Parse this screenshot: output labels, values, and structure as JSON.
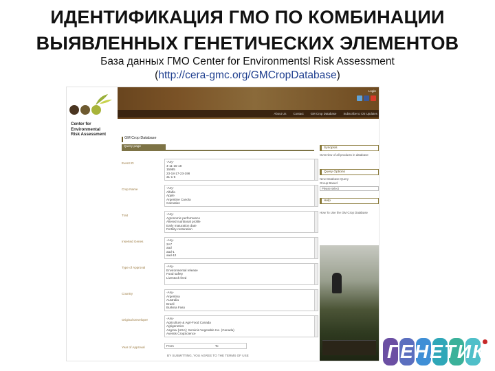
{
  "slide": {
    "title_line1": "ИДЕНТИФИКАЦИЯ ГМО ПО КОМБИНАЦИИ",
    "title_line2": "ВЫЯВЛЕННЫХ ГЕНЕТИЧЕСКИХ ЭЛЕМЕНТОВ",
    "subtitle_line1": "База данных ГМО Center for Environmentsl Risk Assessment",
    "subtitle_open": "(",
    "subtitle_url": "http://cera-gmc.org/GMCropDatabase",
    "subtitle_close": ")"
  },
  "screenshot": {
    "login": "Login",
    "nav": [
      "About Us",
      "Contact",
      "GM Crop Database",
      "Subscribe to CN Updates"
    ],
    "org_name": [
      "Center for",
      "Environmental",
      "Risk Assessment"
    ],
    "db_title": "GM Crop Database",
    "query_tab": "Query page",
    "rows": [
      {
        "label": "Event ID",
        "items": [
          "-Any-",
          "4-11-15-18",
          "15985",
          "23-18-17-23-198",
          "31-1-6"
        ]
      },
      {
        "label": "Crop Name",
        "items": [
          "-Any-",
          "Alfalfa",
          "Apple",
          "Argentine Canola",
          "Carnation"
        ]
      },
      {
        "label": "Trait",
        "items": [
          "-Any-",
          "Agronomic performance",
          "Altered nutritional profile",
          "Early maturation date",
          "Fertility restoration"
        ]
      },
      {
        "label": "Inserted Genes",
        "items": [
          "-Any-",
          "2A7",
          "aad",
          "aad-1",
          "aad-12"
        ]
      },
      {
        "label": "Type of Approval",
        "items": [
          "-Any-",
          "Environmental release",
          "Food safety",
          "Livestock feed"
        ]
      },
      {
        "label": "Country",
        "items": [
          "-Any-",
          "Argentina",
          "Australia",
          "Brazil",
          "Burkina Faso"
        ]
      },
      {
        "label": "Original Developer",
        "items": [
          "-Any-",
          "Agriculture & Agri-Food Canada",
          "Agrigenetics",
          "Asgrow (USA); Seminis Vegetable Inc. (Canada)",
          "Aventis CropScience"
        ]
      },
      {
        "label": "Year of Approval",
        "items": [
          "From",
          "To"
        ]
      }
    ],
    "side": {
      "synopsis_title": "Synopsis",
      "synopsis_text": "Overview of all products in database",
      "options_title": "Query Options",
      "options_text": "New Database Query",
      "group_label": "Group Based",
      "group_value": "Please select",
      "help_title": "Help",
      "help_text": "How To Use the GM Crop Database"
    },
    "footer": "BY SUBMITTING, YOU AGREE TO THE TERMS OF USE"
  },
  "brand": {
    "logo_text": "ГЕНЕТИКА"
  },
  "colors": {
    "banner": "#6e4a20",
    "accent": "#7d7345",
    "label": "#9b7a40",
    "url": "#1f3f8f"
  }
}
